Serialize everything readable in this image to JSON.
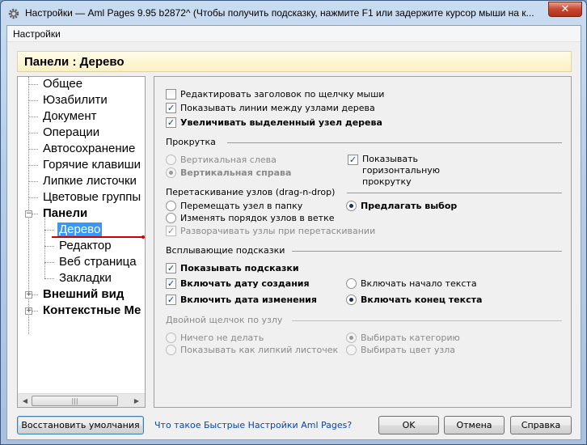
{
  "window": {
    "title": "Настройки  —  Aml Pages 9.95 b2872^ (Чтобы получить подсказку, нажмите F1 или задержите курсор мыши на к...",
    "close_symbol": "✕"
  },
  "menu": {
    "settings": "Настройки"
  },
  "panel": {
    "title": "Панели : Дерево"
  },
  "tree": {
    "items": [
      {
        "label": "Общее"
      },
      {
        "label": "Юзабилити"
      },
      {
        "label": "Документ"
      },
      {
        "label": "Операции"
      },
      {
        "label": "Автосохранение"
      },
      {
        "label": "Горячие клавиши"
      },
      {
        "label": "Липкие листочки"
      },
      {
        "label": "Цветовые группы"
      },
      {
        "label": "Панели",
        "expanded": true
      },
      {
        "label": "Дерево",
        "selected": true
      },
      {
        "label": "Редактор"
      },
      {
        "label": "Веб страница"
      },
      {
        "label": "Закладки"
      },
      {
        "label": "Внешний вид",
        "collapsed": true
      },
      {
        "label": "Контекстные Ме",
        "collapsed": true
      }
    ],
    "expander_minus": "−",
    "expander_plus": "+",
    "scroll_left": "◀",
    "scroll_right": "▶",
    "scroll_grip": "|||"
  },
  "options": {
    "edit_title_on_click": {
      "label": "Редактировать заголовок по щелчку мыши",
      "checked": false
    },
    "show_tree_lines": {
      "label": "Показывать линии между узлами дерева",
      "checked": true
    },
    "enlarge_selected": {
      "label": "Увеличивать выделенный узел дерева",
      "checked": true
    }
  },
  "scroll": {
    "group": "Прокрутка",
    "vertical_left": {
      "label": "Вертикальная слева",
      "selected": false
    },
    "vertical_right": {
      "label": "Вертикальная справа",
      "selected": true
    },
    "show_horizontal": {
      "label": "Показывать горизонтальную прокрутку",
      "checked": true
    }
  },
  "dragdrop": {
    "group": "Перетаскивание узлов (drag-n-drop)",
    "move_to_folder": {
      "label": "Перемещать узел в папку",
      "selected": false
    },
    "reorder": {
      "label": "Изменять порядок узлов в ветке",
      "selected": false
    },
    "offer_choice": {
      "label": "Предлагать выбор",
      "selected": true
    },
    "expand_on_drag": {
      "label": "Разворачивать узлы при перетаскивании",
      "checked": true
    }
  },
  "tooltips": {
    "group": "Всплывающие подсказки",
    "show_tooltips": {
      "label": "Показывать подсказки",
      "checked": true
    },
    "include_created": {
      "label": "Включать дату создания",
      "checked": true
    },
    "include_modified": {
      "label": "Включить дата изменения",
      "checked": true
    },
    "include_text_start": {
      "label": "Включать начало текста",
      "selected": false
    },
    "include_text_end": {
      "label": "Включать конец текста",
      "selected": true
    }
  },
  "doubleclick": {
    "group": "Двойной щелчок по узлу",
    "do_nothing": {
      "label": "Ничего не делать",
      "selected": false
    },
    "show_as_sticky": {
      "label": "Показывать как липкий листочек",
      "selected": false
    },
    "choose_category": {
      "label": "Выбирать категорию",
      "selected": true
    },
    "choose_color": {
      "label": "Выбирать цвет узла",
      "selected": false
    }
  },
  "buttons": {
    "restore_defaults": "Восстановить умолчания",
    "help_link": "Что такое Быстрые Настройки Aml Pages?",
    "ok": "OK",
    "cancel": "Отмена",
    "help": "Справка"
  },
  "check_mark": "✓"
}
